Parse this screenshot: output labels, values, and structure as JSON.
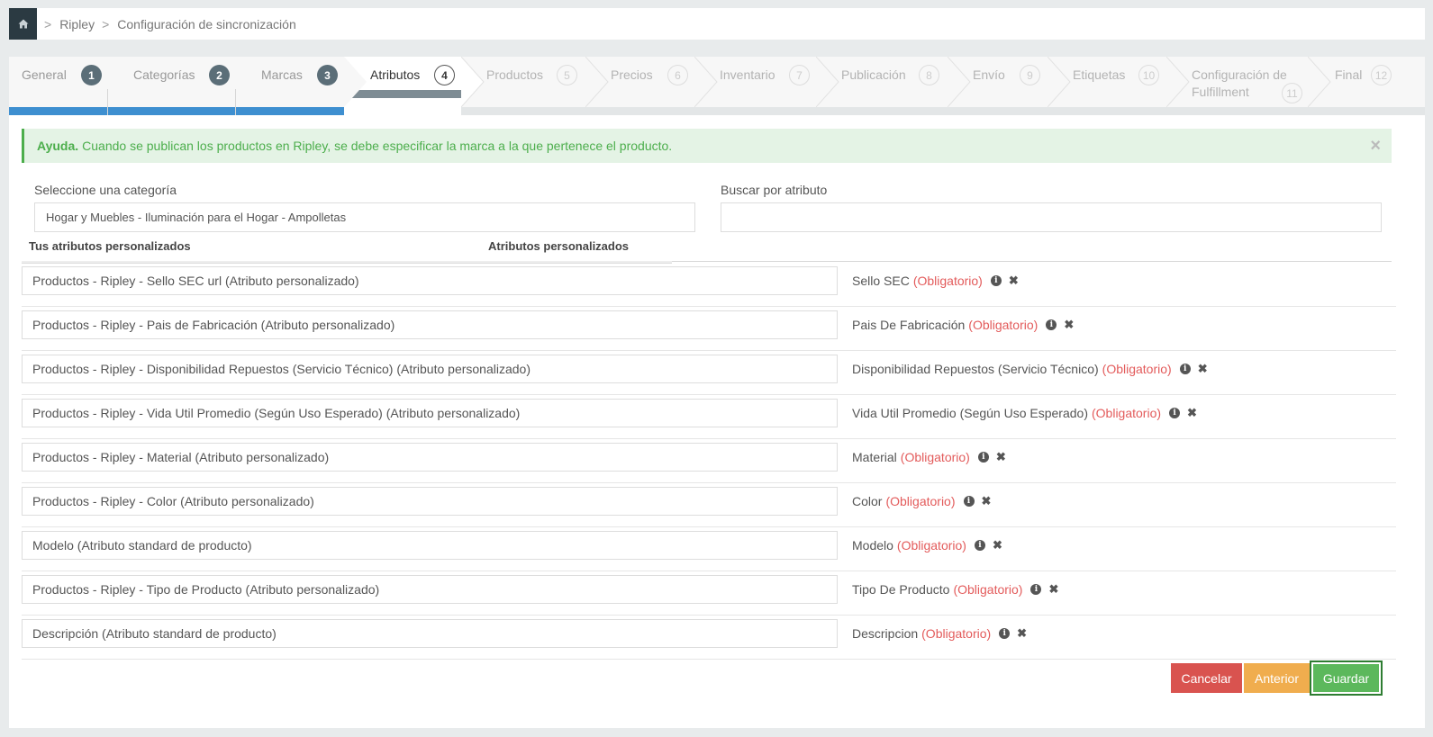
{
  "breadcrumb": {
    "separator": ">",
    "items": [
      "Ripley",
      "Configuración de sincronización"
    ]
  },
  "wizard": {
    "steps": [
      {
        "label": "General",
        "num": "1",
        "state": "done"
      },
      {
        "label": "Categorías",
        "num": "2",
        "state": "done"
      },
      {
        "label": "Marcas",
        "num": "3",
        "state": "done"
      },
      {
        "label": "Atributos",
        "num": "4",
        "state": "active"
      },
      {
        "label": "Productos",
        "num": "5",
        "state": "todo"
      },
      {
        "label": "Precios",
        "num": "6",
        "state": "todo"
      },
      {
        "label": "Inventario",
        "num": "7",
        "state": "todo"
      },
      {
        "label": "Publicación",
        "num": "8",
        "state": "todo"
      },
      {
        "label": "Envío",
        "num": "9",
        "state": "todo"
      },
      {
        "label": "Etiquetas",
        "num": "10",
        "state": "todo"
      },
      {
        "label": "Configuración de Fulfillment",
        "num": "11",
        "state": "todo"
      },
      {
        "label": "Final",
        "num": "12",
        "state": "todo"
      }
    ]
  },
  "alert": {
    "strong": "Ayuda.",
    "text": "Cuando se publican los productos en Ripley, se debe especificar la marca a la que pertenece el producto.",
    "close": "×"
  },
  "form": {
    "category_label": "Seleccione una categoría",
    "category_value": "Hogar y Muebles - Iluminación para el Hogar - Ampolletas",
    "search_label": "Buscar por atributo",
    "search_value": ""
  },
  "columns": {
    "left": "Tus atributos personalizados",
    "right": "Atributos personalizados"
  },
  "required_text": "(Obligatorio)",
  "rows": [
    {
      "mapping": "Productos - Ripley - Sello SEC url (Atributo personalizado)",
      "attribute": "Sello SEC"
    },
    {
      "mapping": "Productos - Ripley - Pais de Fabricación (Atributo personalizado)",
      "attribute": "Pais De Fabricación"
    },
    {
      "mapping": "Productos - Ripley - Disponibilidad Repuestos (Servicio Técnico) (Atributo personalizado)",
      "attribute": "Disponibilidad Repuestos (Servicio Técnico)"
    },
    {
      "mapping": "Productos - Ripley - Vida Util Promedio (Según Uso Esperado) (Atributo personalizado)",
      "attribute": "Vida Util Promedio (Según Uso Esperado)"
    },
    {
      "mapping": "Productos - Ripley - Material (Atributo personalizado)",
      "attribute": "Material"
    },
    {
      "mapping": "Productos - Ripley - Color (Atributo personalizado)",
      "attribute": "Color"
    },
    {
      "mapping": "Modelo (Atributo standard de producto)",
      "attribute": "Modelo"
    },
    {
      "mapping": "Productos - Ripley - Tipo de Producto (Atributo personalizado)",
      "attribute": "Tipo De Producto"
    },
    {
      "mapping": "Descripción (Atributo standard de producto)",
      "attribute": "Descripcion"
    }
  ],
  "buttons": {
    "cancel": "Cancelar",
    "previous": "Anterior",
    "save": "Guardar"
  },
  "colors": {
    "primary": "#3e8fd0",
    "success": "#5cb85c",
    "danger": "#d9534f",
    "warning": "#f0ad4e",
    "required": "#e35b5b"
  },
  "icons": {
    "home": "home-icon",
    "info": "info-icon",
    "remove": "remove-icon",
    "close": "close-icon"
  }
}
